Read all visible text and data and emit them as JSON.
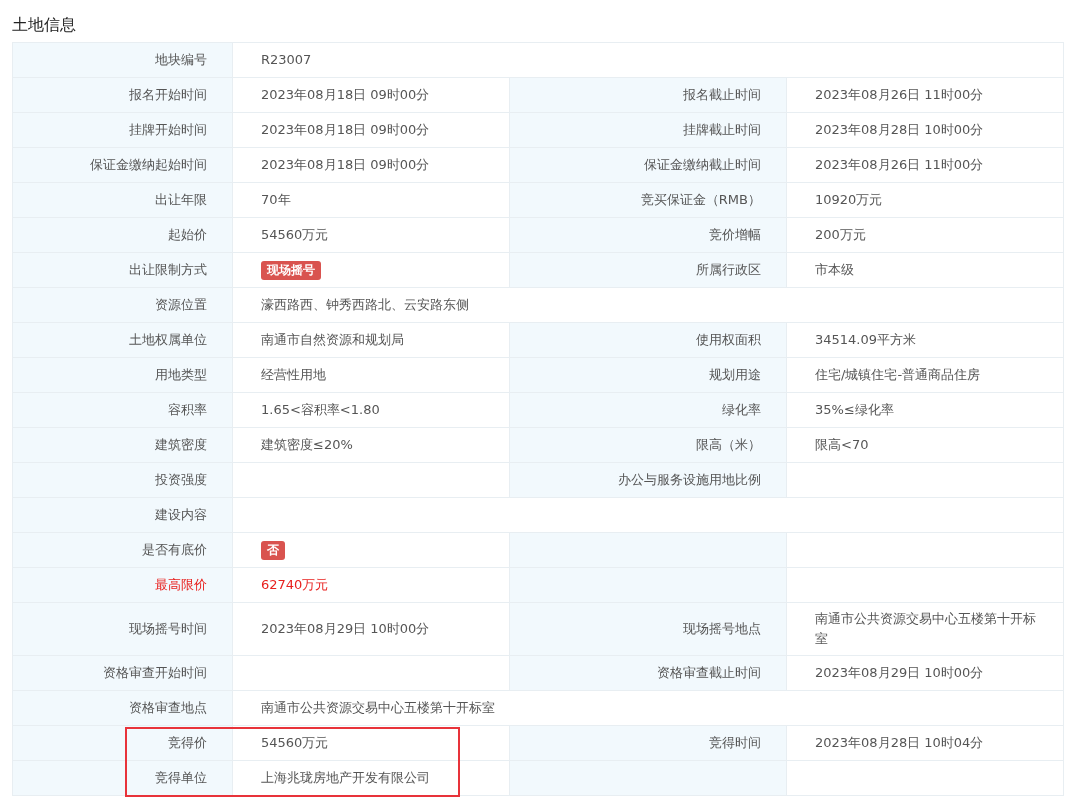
{
  "title": "土地信息",
  "rows": [
    {
      "label": "地块编号",
      "value": {
        "kind": "text",
        "text": "R23007"
      },
      "alert": false,
      "outlined": false
    },
    {
      "label": "报名开始时间",
      "value": {
        "kind": "text",
        "text": "2023年08月18日 09时00分"
      },
      "label2": "报名截止时间",
      "value2": {
        "kind": "text",
        "text": "2023年08月26日 11时00分"
      },
      "alert": false,
      "outlined": false
    },
    {
      "label": "挂牌开始时间",
      "value": {
        "kind": "text",
        "text": "2023年08月18日 09时00分"
      },
      "label2": "挂牌截止时间",
      "value2": {
        "kind": "text",
        "text": "2023年08月28日 10时00分"
      },
      "alert": false,
      "outlined": false
    },
    {
      "label": "保证金缴纳起始时间",
      "value": {
        "kind": "text",
        "text": "2023年08月18日 09时00分"
      },
      "label2": "保证金缴纳截止时间",
      "value2": {
        "kind": "text",
        "text": "2023年08月26日 11时00分"
      },
      "alert": false,
      "outlined": false
    },
    {
      "label": "出让年限",
      "value": {
        "kind": "text",
        "text": "70年"
      },
      "label2": "竞买保证金（RMB）",
      "value2": {
        "kind": "text",
        "text": "10920万元"
      },
      "alert": false,
      "outlined": false
    },
    {
      "label": "起始价",
      "value": {
        "kind": "text",
        "text": "54560万元"
      },
      "label2": "竞价增幅",
      "value2": {
        "kind": "text",
        "text": "200万元"
      },
      "alert": false,
      "outlined": false
    },
    {
      "label": "出让限制方式",
      "value": {
        "kind": "tag",
        "text": "现场摇号"
      },
      "label2": "所属行政区",
      "value2": {
        "kind": "text",
        "text": "市本级"
      },
      "alert": false,
      "outlined": false
    },
    {
      "label": "资源位置",
      "value": {
        "kind": "text",
        "text": "濠西路西、钟秀西路北、云安路东侧"
      },
      "alert": false,
      "outlined": false
    },
    {
      "label": "土地权属单位",
      "value": {
        "kind": "text",
        "text": "南通市自然资源和规划局"
      },
      "label2": "使用权面积",
      "value2": {
        "kind": "text",
        "text": "34514.09平方米"
      },
      "alert": false,
      "outlined": false
    },
    {
      "label": "用地类型",
      "value": {
        "kind": "text",
        "text": "经营性用地"
      },
      "label2": "规划用途",
      "value2": {
        "kind": "text",
        "text": "住宅/城镇住宅-普通商品住房"
      },
      "alert": false,
      "outlined": false
    },
    {
      "label": "容积率",
      "value": {
        "kind": "text",
        "text": "1.65<容积率<1.80"
      },
      "label2": "绿化率",
      "value2": {
        "kind": "text",
        "text": "35%≤绿化率"
      },
      "alert": false,
      "outlined": false
    },
    {
      "label": "建筑密度",
      "value": {
        "kind": "text",
        "text": "建筑密度≤20%"
      },
      "label2": "限高（米）",
      "value2": {
        "kind": "text",
        "text": "限高<70"
      },
      "alert": false,
      "outlined": false
    },
    {
      "label": "投资强度",
      "label2": "办公与服务设施用地比例",
      "alert": false,
      "outlined": false
    },
    {
      "label": "建设内容",
      "alert": false,
      "outlined": false
    },
    {
      "label": "是否有底价",
      "value": {
        "kind": "tag",
        "text": "否"
      },
      "label2": "",
      "alert": false,
      "outlined": false
    },
    {
      "label": "最高限价",
      "value": {
        "kind": "text",
        "text": "62740万元"
      },
      "label2": "",
      "alert": true,
      "outlined": false
    },
    {
      "label": "现场摇号时间",
      "value": {
        "kind": "text",
        "text": "2023年08月29日 10时00分"
      },
      "label2": "现场摇号地点",
      "value2": {
        "kind": "text",
        "text": "南通市公共资源交易中心五楼第十开标室"
      },
      "alert": false,
      "outlined": false
    },
    {
      "label": "资格审查开始时间",
      "label2": "资格审查截止时间",
      "value2": {
        "kind": "text",
        "text": "2023年08月29日 10时00分"
      },
      "alert": false,
      "outlined": false
    },
    {
      "label": "资格审查地点",
      "value": {
        "kind": "text",
        "text": "南通市公共资源交易中心五楼第十开标室"
      },
      "alert": false,
      "outlined": false
    },
    {
      "label": "竞得价",
      "value": {
        "kind": "text",
        "text": "54560万元"
      },
      "label2": "竞得时间",
      "value2": {
        "kind": "text",
        "text": "2023年08月28日 10时04分"
      },
      "alert": false,
      "outlined": true
    },
    {
      "label": "竞得单位",
      "value": {
        "kind": "text",
        "text": "上海兆珑房地产开发有限公司"
      },
      "label2": "",
      "alert": false,
      "outlined": true
    }
  ]
}
